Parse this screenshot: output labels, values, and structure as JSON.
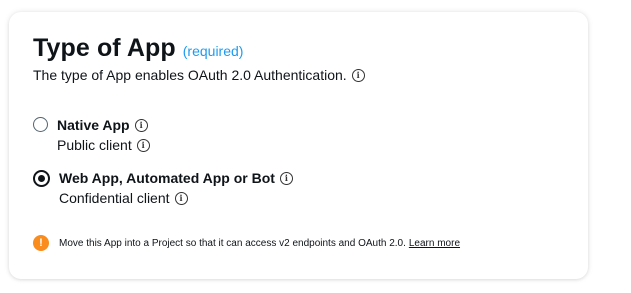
{
  "section": {
    "title": "Type of App",
    "required_label": "(required)",
    "description": "The type of App enables OAuth 2.0 Authentication."
  },
  "options": [
    {
      "label": "Native App",
      "sublabel": "Public client",
      "selected": false
    },
    {
      "label": "Web App, Automated App or Bot",
      "sublabel": "Confidential client",
      "selected": true
    }
  ],
  "notice": {
    "icon": "exclamation-icon",
    "text": "Move this App into a Project so that it can access v2 endpoints and OAuth 2.0.",
    "link_text": "Learn more"
  },
  "colors": {
    "accent": "#1d9bf0",
    "warning": "#f98c1d",
    "text": "#0f1419"
  }
}
